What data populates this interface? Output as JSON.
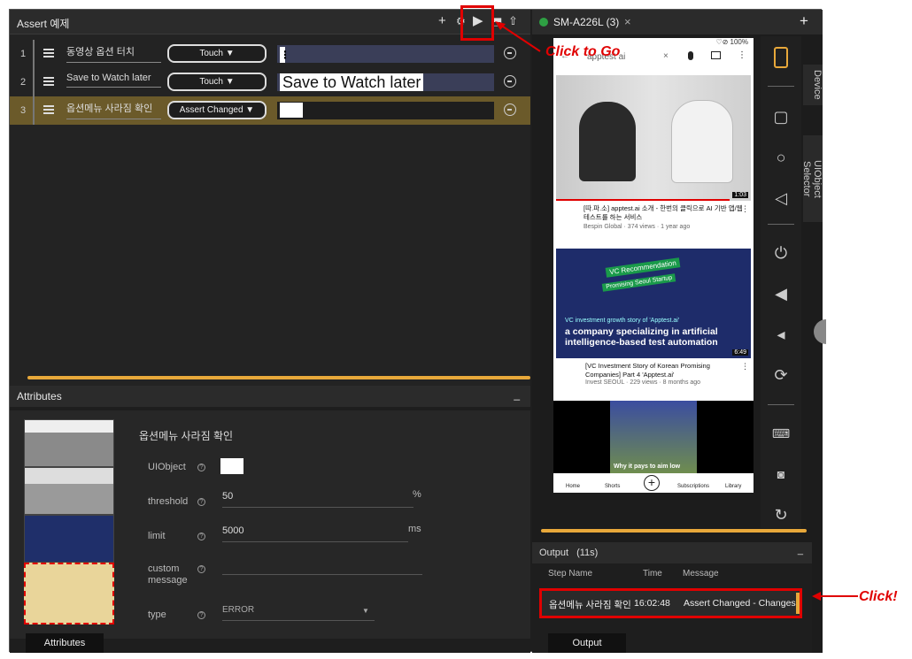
{
  "editor": {
    "title": "Assert 예제",
    "toolbar": {
      "add": "+",
      "settings": "⚙",
      "play": "▶",
      "save": "⬒",
      "export": "⇧"
    }
  },
  "steps": [
    {
      "num": "1",
      "name": "동영상 옵션 터치",
      "action": "Touch ▼",
      "value": "⋮"
    },
    {
      "num": "2",
      "name": "Save to Watch later",
      "action": "Touch ▼",
      "value": "Save to Watch later"
    },
    {
      "num": "3",
      "name": "옵션메뉴 사라짐 확인",
      "action": "Assert Changed ▼",
      "value": ""
    }
  ],
  "attributes": {
    "title": "Attributes",
    "minimize": "_",
    "step_title": "옵션메뉴 사라짐 확인",
    "uiobject_label": "UIObject",
    "threshold_label": "threshold",
    "threshold_value": "50",
    "threshold_unit": "%",
    "limit_label": "limit",
    "limit_value": "5000",
    "limit_unit": "ms",
    "custom_label_1": "custom",
    "custom_label_2": "message",
    "type_label": "type",
    "type_value": "ERROR",
    "bottom_tab": "Attributes"
  },
  "device": {
    "tab_label": "SM-A226L (3)",
    "close": "×",
    "add": "+",
    "vtab_device": "Device",
    "vtab_selector": "UIObject Selector"
  },
  "phone": {
    "status": "♡⊘ 100%",
    "search": "apptest ai",
    "video1_duration": "1:03",
    "video1_title": "[따.파.소] apptest.ai 소개 - 한번의 클릭으로 AI 기반 앱/웹 테스트를 하는 서비스",
    "video1_meta": "Bespin Global · 374 views · 1 year ago",
    "video2_tag1": "VC Recommendation",
    "video2_tag2": "Promising Seoul Startup",
    "video2_line1": "VC investment growth story of 'Apptest.ai'",
    "video2_line2": "a company specializing in artificial intelligence-based test automation",
    "video2_duration": "6:49",
    "video2_title": "[VC Investment Story of Korean Promising Companies] Part 4 'Apptest.ai'",
    "video2_meta": "Invest SEOUL · 229 views · 8 months ago",
    "video3_caption": "Why it pays to aim low",
    "nav": [
      "Home",
      "Shorts",
      "",
      "Subscriptions",
      "Library"
    ]
  },
  "output": {
    "title": "Output",
    "elapsed": "(11s)",
    "col_step": "Step Name",
    "col_time": "Time",
    "col_message": "Message",
    "row_step": "옵션메뉴 사라짐 확인",
    "row_time": "16:02:48",
    "row_message": "Assert Changed - Changes det",
    "bottom_tab": "Output"
  },
  "annotations": {
    "go": "Click to Go",
    "click": "Click!"
  },
  "colors": {
    "accent": "#e8a83a",
    "annotation": "#e00000",
    "highlight_row": "#6b5a2a"
  }
}
